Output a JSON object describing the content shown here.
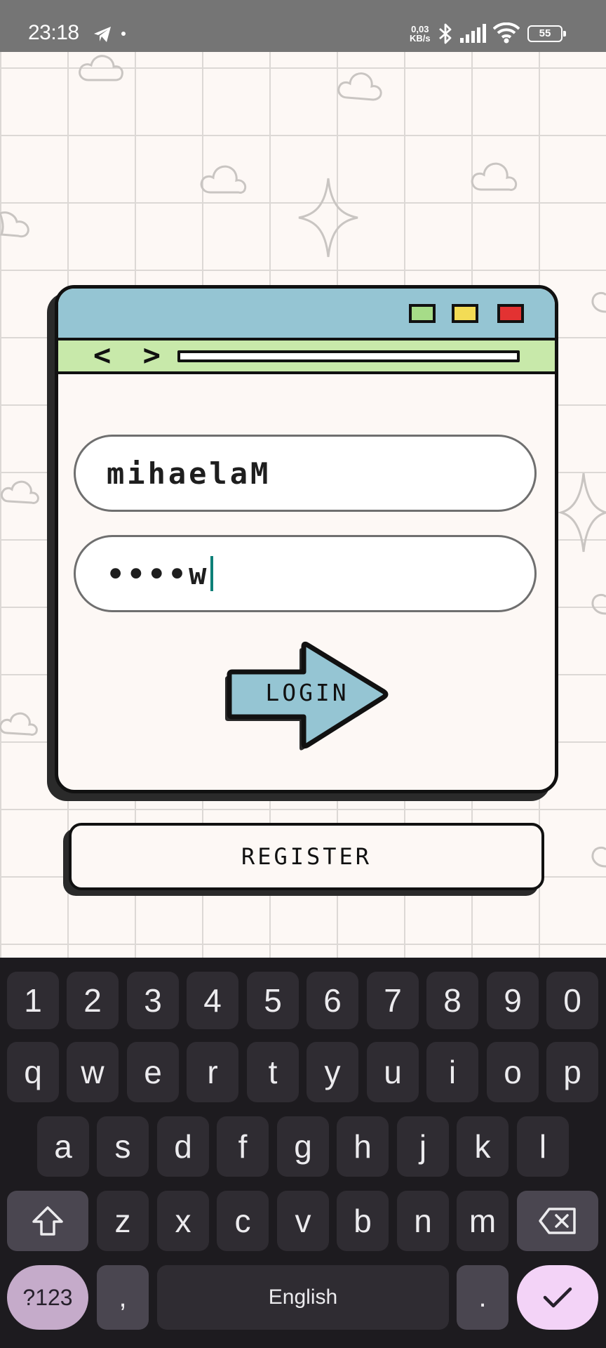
{
  "status_bar": {
    "time": "23:18",
    "net_speed_value": "0,03",
    "net_speed_unit": "KB/s",
    "battery": "55"
  },
  "window": {
    "nav_arrows": "< >"
  },
  "form": {
    "username_value": "mihaelaM",
    "password_value": "••••w",
    "login_label": "LOGIN",
    "register_label": "REGISTER"
  },
  "keyboard": {
    "number_row": [
      "1",
      "2",
      "3",
      "4",
      "5",
      "6",
      "7",
      "8",
      "9",
      "0"
    ],
    "row1": [
      "q",
      "w",
      "e",
      "r",
      "t",
      "y",
      "u",
      "i",
      "o",
      "p"
    ],
    "row2": [
      "a",
      "s",
      "d",
      "f",
      "g",
      "h",
      "j",
      "k",
      "l"
    ],
    "row3": [
      "z",
      "x",
      "c",
      "v",
      "b",
      "n",
      "m"
    ],
    "symbols_label": "?123",
    "comma": ",",
    "space_label": "English",
    "period": "."
  },
  "colors": {
    "titlebar": "#95c5d3",
    "addressbar": "#c8e9aa",
    "win_green": "#a6dc88",
    "win_yellow": "#f3dc55",
    "win_red": "#e33232",
    "caret": "#0e8078",
    "enter_key": "#f3d3f7"
  }
}
